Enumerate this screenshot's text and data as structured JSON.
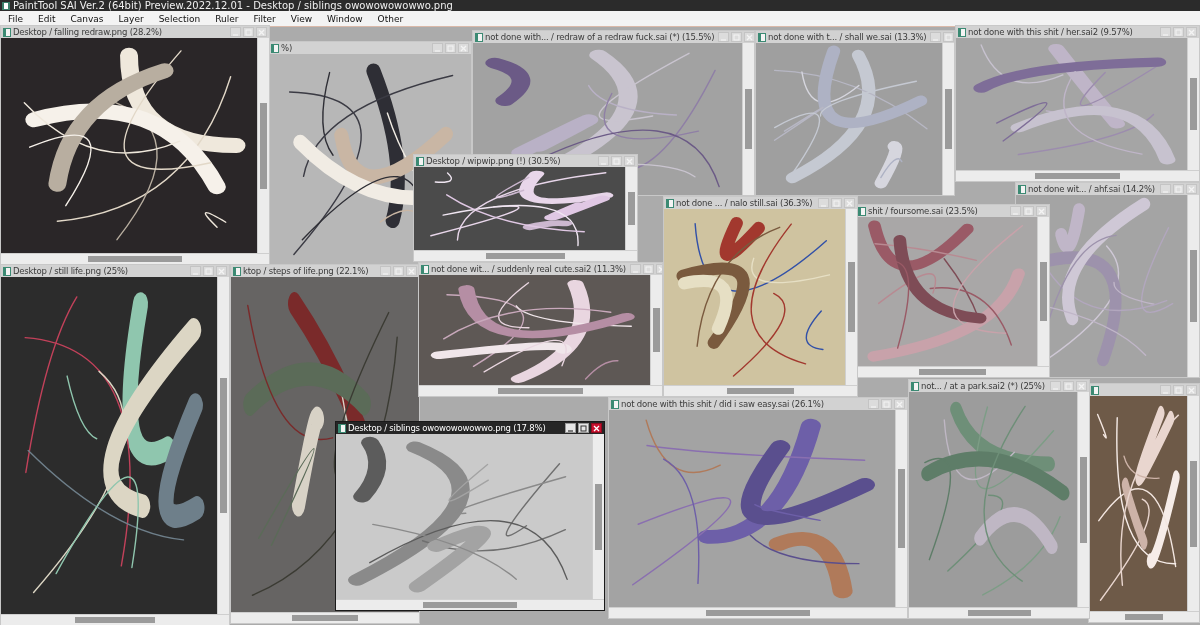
{
  "app_title": "PaintTool SAI Ver.2 (64bit) Preview.2022.12.01 - Desktop / siblings owowowowowwo.png",
  "menu": [
    "File",
    "Edit",
    "Canvas",
    "Layer",
    "Selection",
    "Ruler",
    "Filter",
    "View",
    "Window",
    "Other"
  ],
  "windows": [
    {
      "title": "Desktop / falling redraw.png (28.2%)",
      "active": false
    },
    {
      "title": "%)",
      "active": false
    },
    {
      "title": "not done with...  / redraw of a redraw fuck.sai (*) (15.5%)",
      "active": false
    },
    {
      "title": "not done with t... / shall we.sai (13.3%)",
      "active": false
    },
    {
      "title": "not done with this shit / her.sai2 (9.57%)",
      "active": false
    },
    {
      "title": "Desktop / wipwip.png (!) (30.5%)",
      "active": false
    },
    {
      "title": "not done ...  / nalo still.sai (36.3%)",
      "active": false
    },
    {
      "title": "shit / foursome.sai (23.5%)",
      "active": false
    },
    {
      "title": "not done wit... / ahf.sai (14.2%)",
      "active": false
    },
    {
      "title": "Desktop / still life.png (25%)",
      "active": false
    },
    {
      "title": "ktop / steps of life.png (22.1%)",
      "active": false
    },
    {
      "title": "not done wit... / suddenly real cute.sai2 (11.3%)",
      "active": false
    },
    {
      "title": "Desktop / siblings owowowowowwo.png (17.8%)",
      "active": true
    },
    {
      "title": "not done with this shit / did i saw easy.sai (26.1%)",
      "active": false
    },
    {
      "title": "not... / at a park.sai2 (*) (25%)",
      "active": false
    },
    {
      "active": false
    }
  ]
}
